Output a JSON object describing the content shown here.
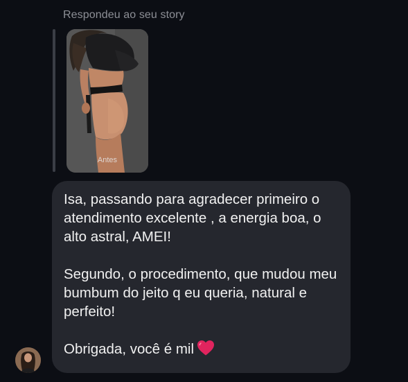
{
  "reply_header": "Respondeu ao seu story",
  "story": {
    "caption": "Antes",
    "image": "story-photo-before"
  },
  "message": {
    "paragraph1": "Isa, passando para agradecer primeiro o atendimento excelente , a energia boa, o alto astral, AMEI!",
    "paragraph2": "Segundo, o procedimento, que mudou meu bumbum do jeito q eu queria, natural e perfeito!",
    "paragraph3": "Obrigada, você é mil",
    "emoji": "heart-icon"
  },
  "sender": {
    "avatar": "profile-avatar"
  },
  "colors": {
    "background": "#0c0e14",
    "bubble": "#25272e",
    "heart": "#e0245e",
    "muted_text": "#8d8f96"
  }
}
